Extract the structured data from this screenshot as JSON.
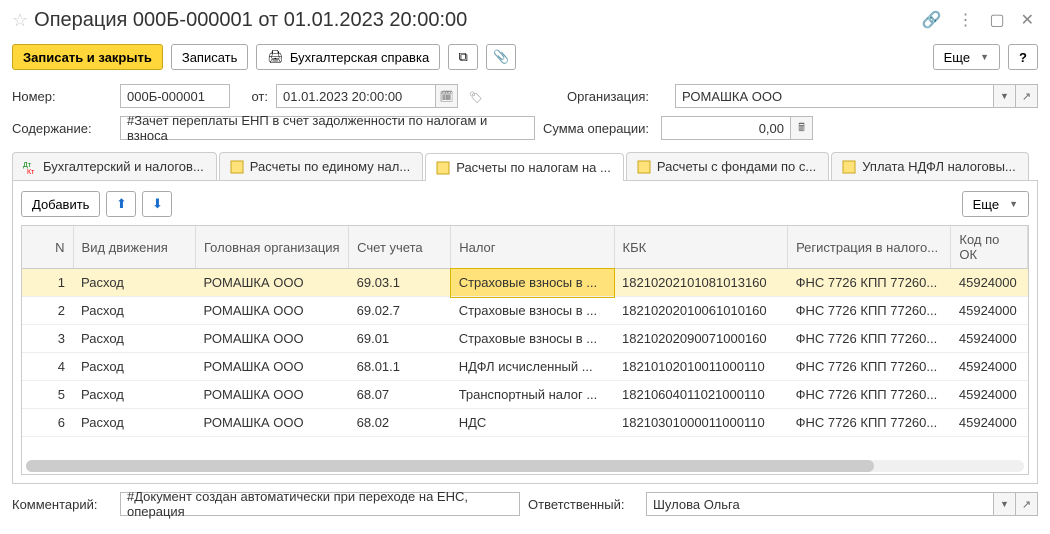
{
  "title": "Операция 000Б-000001 от 01.01.2023 20:00:00",
  "toolbar": {
    "save_close": "Записать и закрыть",
    "save": "Записать",
    "report": "Бухгалтерская справка",
    "more": "Еще"
  },
  "form": {
    "number_label": "Номер:",
    "number": "000Б-000001",
    "from_label": "от:",
    "date": "01.01.2023 20:00:00",
    "org_label": "Организация:",
    "org": "РОМАШКА ООО",
    "content_label": "Содержание:",
    "content": "#Зачет переплаты ЕНП в счет задолженности по налогам и взноса",
    "sum_label": "Сумма операции:",
    "sum": "0,00"
  },
  "tabs": [
    "Бухгалтерский и налогов...",
    "Расчеты по единому нал...",
    "Расчеты по налогам на ...",
    "Расчеты с фондами по с...",
    "Уплата НДФЛ налоговы..."
  ],
  "tableToolbar": {
    "add": "Добавить",
    "more": "Еще"
  },
  "columns": {
    "n": "N",
    "vid": "Вид движения",
    "org": "Головная организация",
    "acc": "Счет учета",
    "tax": "Налог",
    "kbk": "КБК",
    "reg": "Регистрация в налого...",
    "kod": "Код по ОК"
  },
  "rows": [
    {
      "n": "1",
      "vid": "Расход",
      "org": "РОМАШКА ООО",
      "acc": "69.03.1",
      "tax": "Страховые взносы в ...",
      "kbk": "18210202101081013160",
      "reg": "ФНС 7726 КПП 77260...",
      "kod": "45924000"
    },
    {
      "n": "2",
      "vid": "Расход",
      "org": "РОМАШКА ООО",
      "acc": "69.02.7",
      "tax": "Страховые взносы в ...",
      "kbk": "18210202010061010160",
      "reg": "ФНС 7726 КПП 77260...",
      "kod": "45924000"
    },
    {
      "n": "3",
      "vid": "Расход",
      "org": "РОМАШКА ООО",
      "acc": "69.01",
      "tax": "Страховые взносы в ...",
      "kbk": "18210202090071000160",
      "reg": "ФНС 7726 КПП 77260...",
      "kod": "45924000"
    },
    {
      "n": "4",
      "vid": "Расход",
      "org": "РОМАШКА ООО",
      "acc": "68.01.1",
      "tax": "НДФЛ исчисленный ...",
      "kbk": "18210102010011000110",
      "reg": "ФНС 7726 КПП 77260...",
      "kod": "45924000"
    },
    {
      "n": "5",
      "vid": "Расход",
      "org": "РОМАШКА ООО",
      "acc": "68.07",
      "tax": "Транспортный налог ...",
      "kbk": "18210604011021000110",
      "reg": "ФНС 7726 КПП 77260...",
      "kod": "45924000"
    },
    {
      "n": "6",
      "vid": "Расход",
      "org": "РОМАШКА ООО",
      "acc": "68.02",
      "tax": "НДС",
      "kbk": "18210301000011000110",
      "reg": "ФНС 7726 КПП 77260...",
      "kod": "45924000"
    }
  ],
  "footer": {
    "comment_label": "Комментарий:",
    "comment": "#Документ создан автоматически при переходе на ЕНС, операция",
    "resp_label": "Ответственный:",
    "resp": "Шулова Ольга"
  }
}
